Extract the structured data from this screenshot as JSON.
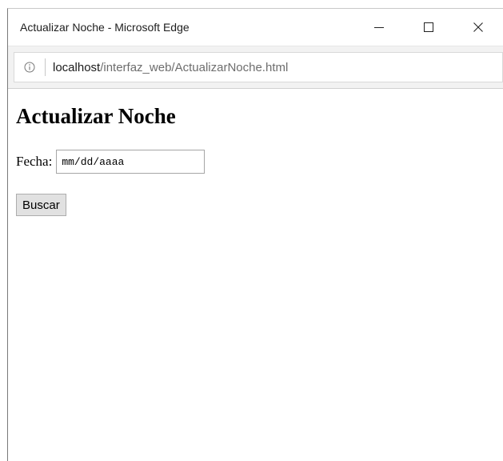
{
  "window": {
    "title": "Actualizar Noche - Microsoft Edge",
    "controls": [
      "minimize-icon",
      "maximize-icon",
      "close-icon"
    ]
  },
  "addressbar": {
    "info_icon": "info-icon",
    "url_host": "localhost",
    "url_path": "/interfaz_web/ActualizarNoche.html"
  },
  "page": {
    "heading": "Actualizar Noche",
    "fecha_label": "Fecha:",
    "fecha_placeholder": "mm/dd/aaaa",
    "fecha_value": "",
    "buscar_label": "Buscar"
  }
}
